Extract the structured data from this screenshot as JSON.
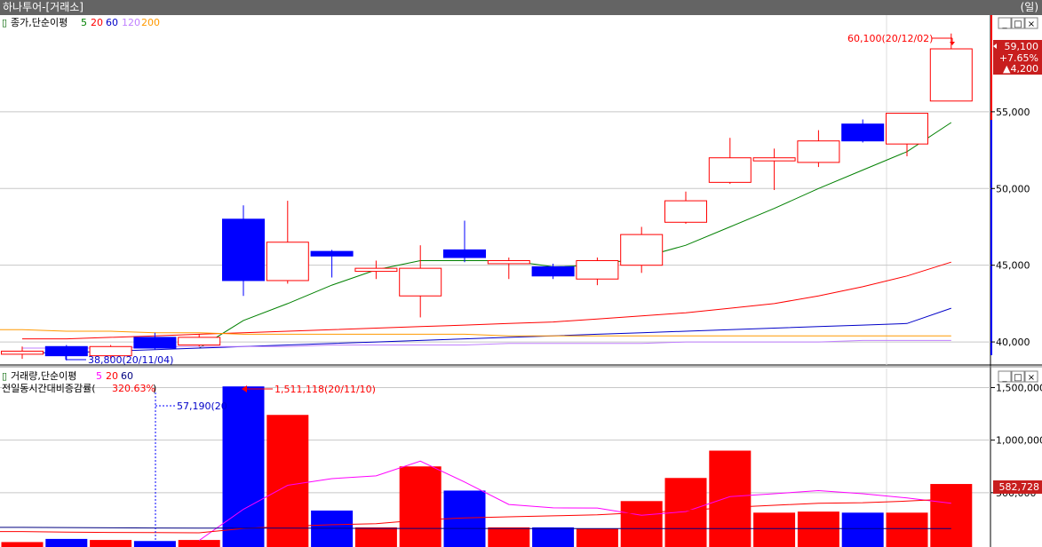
{
  "window": {
    "title": "하나투어-[거래소]",
    "period": "(일)"
  },
  "theme": {
    "up": "#ff0000",
    "down": "#0000ff",
    "ma5": "#008000",
    "ma20": "#ff0000",
    "ma60": "#0000c8",
    "ma120": "#c080ff",
    "ma200": "#ff9900",
    "grid": "#c8c8c8"
  },
  "price_panel": {
    "legend": {
      "label": "종가,단순이평",
      "periods": [
        "5",
        "20",
        "60",
        "120",
        "200"
      ]
    },
    "controls": [
      "_",
      "□",
      "×"
    ],
    "axis_ticks": [
      {
        "value": 55000,
        "label": "55,000"
      },
      {
        "value": 50000,
        "label": "50,000"
      },
      {
        "value": 45000,
        "label": "45,000"
      },
      {
        "value": 40000,
        "label": "40,000"
      }
    ],
    "high_note": "60,100(20/12/02)",
    "low_note": "38,800(20/11/04)",
    "current": {
      "price": "59,100",
      "change_pct": "+7.65%",
      "change": "▲4,200"
    }
  },
  "volume_panel": {
    "legend": {
      "label": "거래량,단순이평",
      "periods": [
        "5",
        "20",
        "60"
      ]
    },
    "subtitle": "전일동시간대비증감률(",
    "subtitle_value": "320.63%",
    "subtitle_close": ")",
    "controls": [
      "_",
      "□",
      "×"
    ],
    "axis_ticks": [
      {
        "value": 1500000,
        "label": "1,500,000"
      },
      {
        "value": 1000000,
        "label": "1,000,000"
      },
      {
        "value": 500000,
        "label": "500,000"
      }
    ],
    "high_note": "1,511,118(20/11/10)",
    "ref_note": "57,190(20",
    "current_label": "582,728"
  },
  "chart_data": [
    {
      "type": "candlestick",
      "title": "",
      "ylim": [
        38500,
        61300
      ],
      "grid": true,
      "candles": [
        {
          "o": 39200,
          "h": 39700,
          "l": 38900,
          "c": 39400
        },
        {
          "o": 39700,
          "h": 39800,
          "l": 38800,
          "c": 39100
        },
        {
          "o": 39100,
          "h": 39800,
          "l": 38900,
          "c": 39700
        },
        {
          "o": 40300,
          "h": 40600,
          "l": 39500,
          "c": 39600
        },
        {
          "o": 39800,
          "h": 40500,
          "l": 39700,
          "c": 40300
        },
        {
          "o": 48000,
          "h": 48900,
          "l": 43000,
          "c": 44000
        },
        {
          "o": 44000,
          "h": 49200,
          "l": 43800,
          "c": 46500
        },
        {
          "o": 45900,
          "h": 46000,
          "l": 44200,
          "c": 45600
        },
        {
          "o": 44600,
          "h": 45300,
          "l": 44100,
          "c": 44800
        },
        {
          "o": 43000,
          "h": 46300,
          "l": 41600,
          "c": 44800
        },
        {
          "o": 46000,
          "h": 47900,
          "l": 45200,
          "c": 45500
        },
        {
          "o": 45100,
          "h": 45500,
          "l": 44100,
          "c": 45300
        },
        {
          "o": 44900,
          "h": 45100,
          "l": 44100,
          "c": 44300
        },
        {
          "o": 44100,
          "h": 45500,
          "l": 43700,
          "c": 45300
        },
        {
          "o": 45000,
          "h": 47500,
          "l": 44500,
          "c": 47000
        },
        {
          "o": 47800,
          "h": 49800,
          "l": 47700,
          "c": 49200
        },
        {
          "o": 50400,
          "h": 53300,
          "l": 50300,
          "c": 52000
        },
        {
          "o": 51800,
          "h": 52600,
          "l": 49900,
          "c": 52000
        },
        {
          "o": 51700,
          "h": 53800,
          "l": 51400,
          "c": 53100
        },
        {
          "o": 54200,
          "h": 54500,
          "l": 53000,
          "c": 53100
        },
        {
          "o": 52900,
          "h": 54900,
          "l": 52100,
          "c": 54900
        },
        {
          "o": 55700,
          "h": 60100,
          "l": 55700,
          "c": 59100
        }
      ],
      "series": [
        {
          "name": "5",
          "values": [
            null,
            null,
            null,
            null,
            39600,
            41400,
            42500,
            43700,
            44700,
            45300,
            45300,
            45300,
            44900,
            45000,
            45500,
            46300,
            47500,
            48700,
            50000,
            51200,
            52400,
            54300
          ]
        },
        {
          "name": "20",
          "values": [
            40200,
            40200,
            40300,
            40400,
            40500,
            40600,
            40700,
            40800,
            40900,
            41000,
            41100,
            41200,
            41300,
            41500,
            41700,
            41900,
            42200,
            42500,
            43000,
            43600,
            44300,
            45200
          ]
        },
        {
          "name": "60",
          "values": [
            39300,
            39300,
            39400,
            39500,
            39600,
            39700,
            39800,
            39900,
            40000,
            40100,
            40200,
            40300,
            40400,
            40500,
            40600,
            40700,
            40800,
            40900,
            41000,
            41100,
            41200,
            42200
          ]
        },
        {
          "name": "120",
          "values": [
            39600,
            39600,
            39600,
            39700,
            39700,
            39700,
            39700,
            39800,
            39800,
            39800,
            39800,
            39900,
            39900,
            39900,
            39900,
            40000,
            40000,
            40000,
            40000,
            40100,
            40100,
            40100
          ]
        },
        {
          "name": "200",
          "values": [
            40800,
            40700,
            40700,
            40600,
            40600,
            40500,
            40500,
            40500,
            40500,
            40500,
            40500,
            40400,
            40400,
            40400,
            40400,
            40400,
            40400,
            40400,
            40400,
            40400,
            40400,
            40400
          ]
        }
      ]
    },
    {
      "type": "bar",
      "title": "",
      "ylim": [
        0,
        1690000
      ],
      "grid": true,
      "values": [
        30000,
        60000,
        50000,
        40000,
        50000,
        1511118,
        1240000,
        330000,
        170000,
        750000,
        520000,
        170000,
        170000,
        160000,
        420000,
        640000,
        900000,
        310000,
        320000,
        310000,
        310000,
        582728
      ],
      "directions": [
        "up",
        "down",
        "up",
        "down",
        "up",
        "down",
        "up",
        "down",
        "up",
        "up",
        "down",
        "up",
        "down",
        "up",
        "up",
        "up",
        "up",
        "up",
        "up",
        "down",
        "up",
        "up"
      ],
      "series": [
        {
          "name": "5",
          "values": [
            null,
            null,
            null,
            null,
            46000,
            342000,
            570000,
            634000,
            660000,
            800000,
            602000,
            388000,
            356000,
            354000,
            286000,
            320000,
            462000,
            490000,
            520000,
            490000,
            450000,
            400000
          ]
        },
        {
          "name": "20",
          "values": [
            130000,
            125000,
            122000,
            120000,
            118000,
            160000,
            180000,
            195000,
            205000,
            240000,
            260000,
            270000,
            280000,
            290000,
            310000,
            330000,
            360000,
            380000,
            400000,
            405000,
            420000,
            440000
          ]
        },
        {
          "name": "60",
          "values": [
            170000,
            168000,
            166000,
            164000,
            162000,
            162000,
            162000,
            161000,
            160000,
            160000,
            160000,
            159000,
            158000,
            158000,
            158000,
            158000,
            158000,
            158000,
            158000,
            158000,
            158000,
            158000
          ]
        }
      ]
    }
  ]
}
